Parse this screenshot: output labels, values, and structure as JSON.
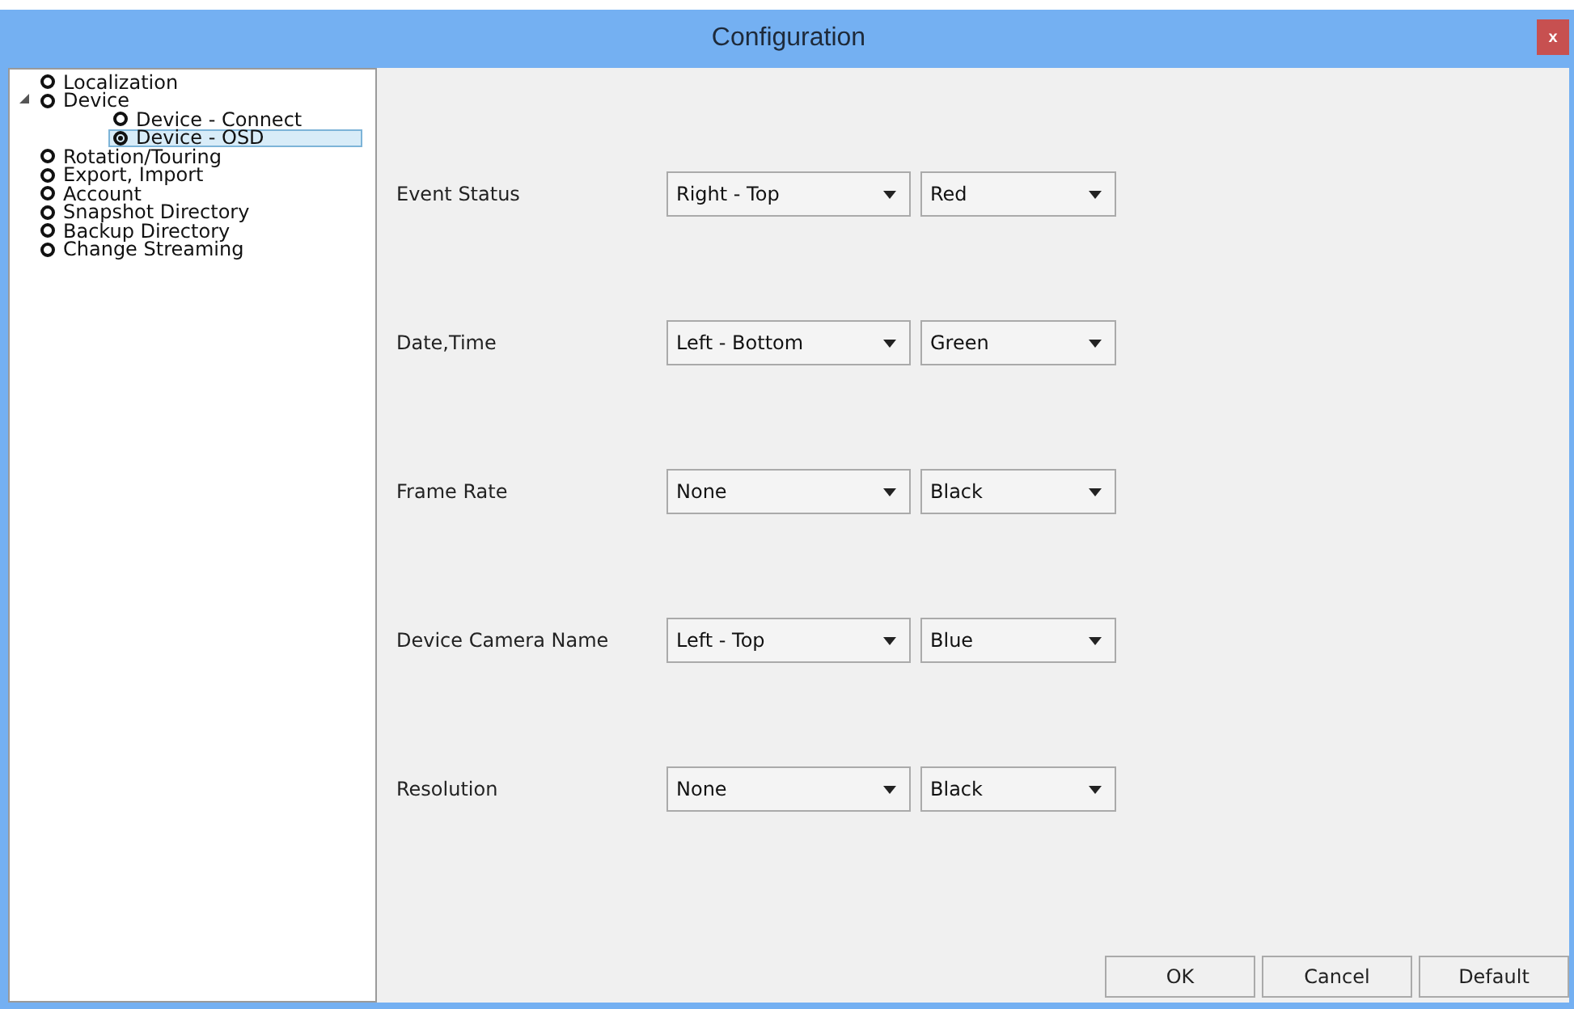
{
  "window": {
    "title": "Configuration",
    "close": "x"
  },
  "tree": [
    {
      "label": "Localization",
      "selected": false
    },
    {
      "label": "Device",
      "selected": false,
      "expanded": true,
      "children": [
        {
          "label": "Device - Connect",
          "selected": false
        },
        {
          "label": "Device - OSD",
          "selected": true
        }
      ]
    },
    {
      "label": "Rotation/Touring",
      "selected": false
    },
    {
      "label": "Export, Import",
      "selected": false
    },
    {
      "label": "Account",
      "selected": false
    },
    {
      "label": "Snapshot Directory",
      "selected": false
    },
    {
      "label": "Backup Directory",
      "selected": false
    },
    {
      "label": "Change Streaming",
      "selected": false
    }
  ],
  "osd_rows": [
    {
      "label": "Event Status",
      "position": "Right - Top",
      "color_choice": "Red"
    },
    {
      "label": "Date,Time",
      "position": "Left - Bottom",
      "color_choice": "Green"
    },
    {
      "label": "Frame Rate",
      "position": "None",
      "color_choice": "Black"
    },
    {
      "label": "Device Camera Name",
      "position": "Left - Top",
      "color_choice": "Blue"
    },
    {
      "label": "Resolution",
      "position": "None",
      "color_choice": "Black"
    }
  ],
  "buttons": [
    "OK",
    "Cancel",
    "Default"
  ]
}
